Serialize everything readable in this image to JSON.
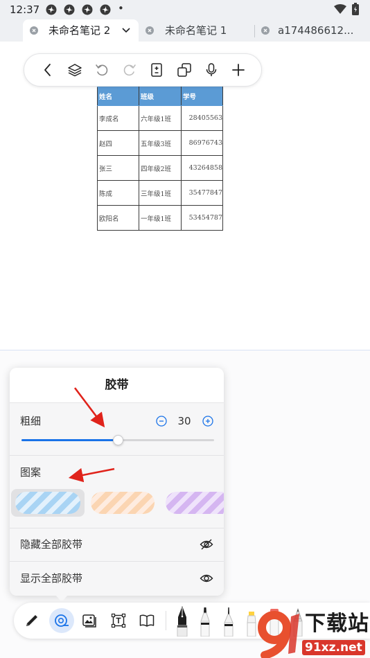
{
  "status_bar": {
    "time": "12:37",
    "dot": "•",
    "icons": [
      "pinwheel-icon",
      "pinwheel-icon",
      "pinwheel-icon",
      "pinwheel-icon",
      "wifi-icon",
      "battery-icon"
    ]
  },
  "tabs": [
    {
      "label": "未命名笔记 2",
      "active": true
    },
    {
      "label": "未命名笔记 1",
      "active": false
    },
    {
      "label": "a174486612...",
      "active": false
    }
  ],
  "toolbar": {
    "icons": [
      "back-icon",
      "layers-icon",
      "undo-icon",
      "redo-icon",
      "page-icon",
      "duplicate-icon",
      "microphone-icon",
      "add-icon"
    ]
  },
  "table": {
    "headers": [
      "姓名",
      "班级",
      "学号"
    ],
    "rows": [
      [
        "李成名",
        "六年级1班",
        "28405563"
      ],
      [
        "赵四",
        "五年级3班",
        "86976743"
      ],
      [
        "张三",
        "四年级2班",
        "43264858"
      ],
      [
        "陈成",
        "三年级1班",
        "35477847"
      ],
      [
        "欧阳名",
        "一年级1班",
        "53454787"
      ]
    ]
  },
  "tape_panel": {
    "title": "胶带",
    "thickness_label": "粗细",
    "thickness_value": "30",
    "slider_fraction": 0.5,
    "pattern_label": "图案",
    "patterns": [
      {
        "name": "blue-stripe",
        "color": "#a9d4f4",
        "stripe": "#e3f1fc",
        "selected": true
      },
      {
        "name": "orange-stripe",
        "color": "#fbd5b2",
        "stripe": "#feece0",
        "selected": false
      },
      {
        "name": "purple-stripe",
        "color": "#d5b6f1",
        "stripe": "#efe3fb",
        "selected": false
      }
    ],
    "hide_all": "隐藏全部胶带",
    "show_all": "显示全部胶带"
  },
  "bottom_toolbar": {
    "icons": [
      "pen-icon",
      "tape-icon",
      "image-icon",
      "text-box-icon",
      "book-icon",
      "fountain-pen-icon",
      "marker-icon",
      "fine-marker-icon",
      "highlighter-icon",
      "red-marker-icon",
      "pencil-icon",
      "add-tool-icon"
    ]
  },
  "watermark": {
    "brand": "下载站",
    "url": "91xz.net"
  },
  "colors": {
    "accent": "#1a73e8",
    "table_header": "#5b9bd5",
    "annotation": "#e0231b",
    "watermark": "#d9362b"
  }
}
